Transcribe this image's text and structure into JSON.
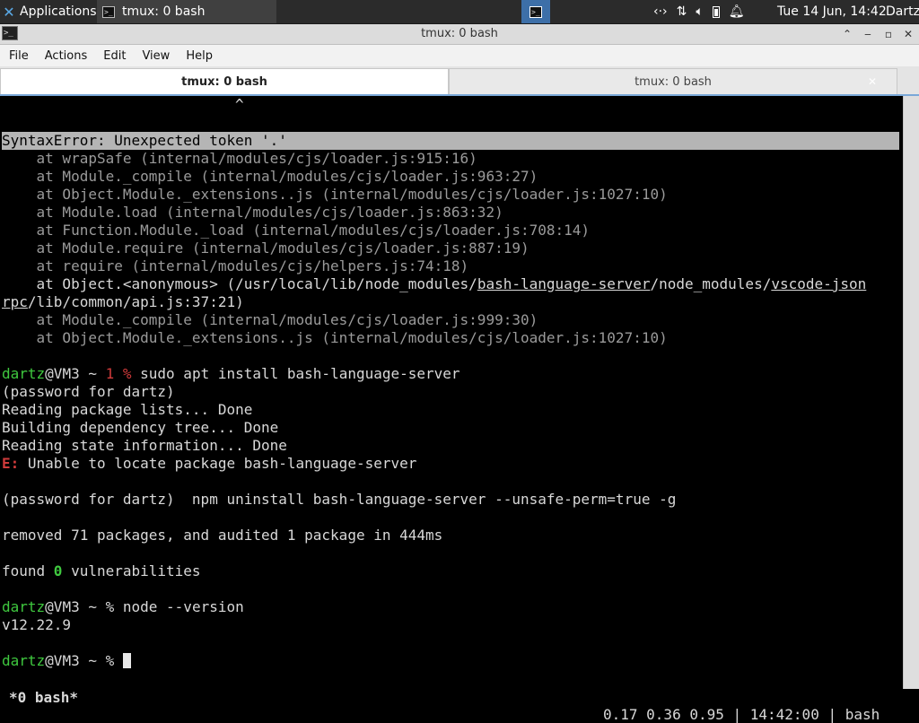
{
  "panel": {
    "apps_label": "Applications",
    "task_label": "tmux: 0 bash",
    "clock": "Tue 14 Jun, 14:42",
    "user": "Dartz"
  },
  "window": {
    "title": "tmux: 0 bash"
  },
  "menu": {
    "file": "File",
    "actions": "Actions",
    "edit": "Edit",
    "view": "View",
    "help": "Help"
  },
  "tabs": [
    {
      "label": "tmux: 0 bash",
      "active": true
    },
    {
      "label": "tmux: 0 bash",
      "active": false
    }
  ],
  "terminal": {
    "caret_line": "^",
    "error_line": "SyntaxError: Unexpected token '.'",
    "stack": [
      "    at wrapSafe (internal/modules/cjs/loader.js:915:16)",
      "    at Module._compile (internal/modules/cjs/loader.js:963:27)",
      "    at Object.Module._extensions..js (internal/modules/cjs/loader.js:1027:10)",
      "    at Module.load (internal/modules/cjs/loader.js:863:32)",
      "    at Function.Module._load (internal/modules/cjs/loader.js:708:14)",
      "    at Module.require (internal/modules/cjs/loader.js:887:19)",
      "    at require (internal/modules/cjs/helpers.js:74:18)"
    ],
    "anon": {
      "pre": "    at Object.<anonymous> (/usr/local/lib/node_modules/",
      "link1": "bash-language-server",
      "mid": "/node_modules/",
      "link2": "vscode-json",
      "cont_link": "rpc",
      "cont_rest": "/lib/common/api.js:37:21)"
    },
    "stack2": [
      "    at Module._compile (internal/modules/cjs/loader.js:999:30)",
      "    at Object.Module._extensions..js (internal/modules/cjs/loader.js:1027:10)"
    ],
    "prompt_user": "dartz",
    "prompt_host": "@VM3 ~ ",
    "prompt_exit": "1 % ",
    "cmd_apt": "sudo apt install bash-language-server",
    "pw_line": "(password for dartz)",
    "apt_out": [
      "Reading package lists... Done",
      "Building dependency tree... Done",
      "Reading state information... Done"
    ],
    "err_prefix": "E:",
    "err_msg": " Unable to locate package bash-language-server",
    "npm_line": "(password for dartz)  npm uninstall bash-language-server --unsafe-perm=true -g",
    "removed_line": "removed 71 packages, and audited 1 package in 444ms",
    "found_pre": "found ",
    "found_num": "0",
    "found_post": " vulnerabilities",
    "prompt_sym": "% ",
    "cmd_node": "node --version",
    "node_version": "v12.22.9"
  },
  "status": {
    "left": "*0 bash*",
    "right": "0.17 0.36 0.95 | 14:42:00 | bash"
  }
}
